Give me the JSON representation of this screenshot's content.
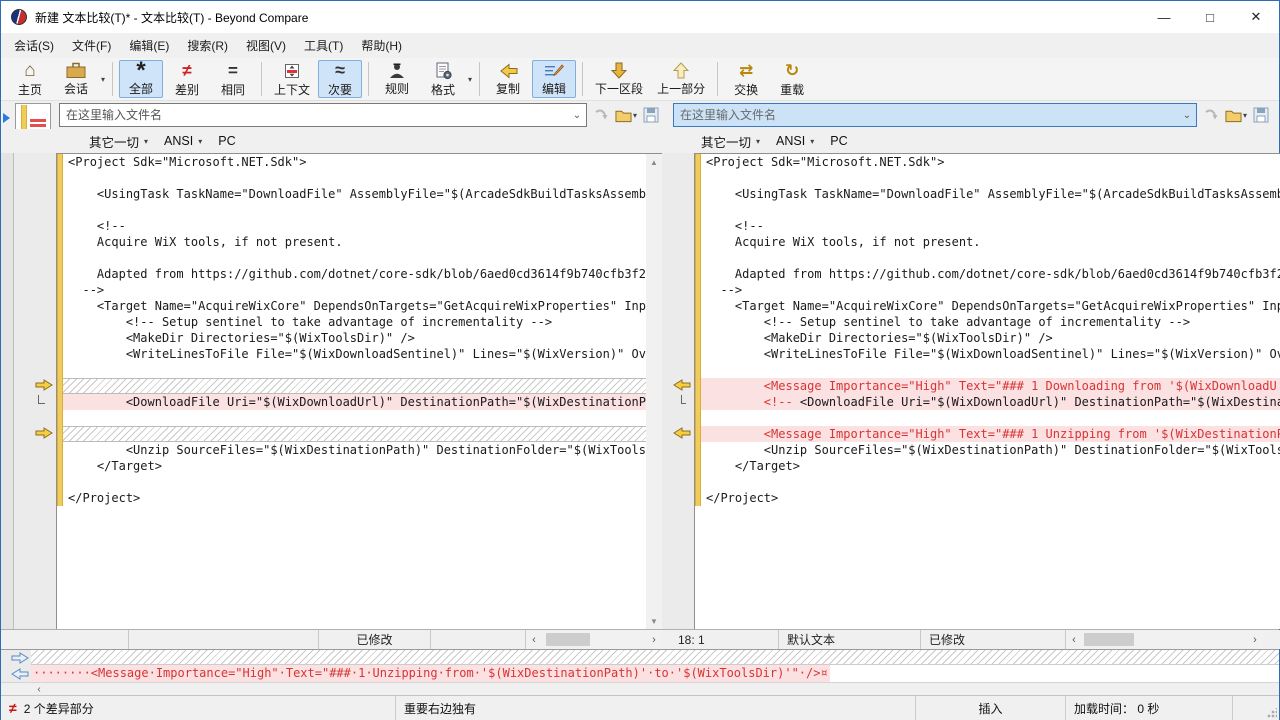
{
  "titlebar": {
    "title": "新建 文本比较(T)* - 文本比较(T) - Beyond Compare",
    "minimize": "—",
    "maximize": "□",
    "close": "✕"
  },
  "menubar": [
    "会话(S)",
    "文件(F)",
    "编辑(E)",
    "搜索(R)",
    "视图(V)",
    "工具(T)",
    "帮助(H)"
  ],
  "toolbar": {
    "groups": [
      [
        {
          "name": "home",
          "label": "主页"
        },
        {
          "name": "sessions",
          "label": "会话",
          "dropdown": true
        }
      ],
      [
        {
          "name": "all",
          "label": "全部",
          "active": true
        },
        {
          "name": "differences",
          "label": "差别"
        },
        {
          "name": "same",
          "label": "相同"
        }
      ],
      [
        {
          "name": "context",
          "label": "上下文"
        },
        {
          "name": "minor",
          "label": "次要",
          "active": true
        }
      ],
      [
        {
          "name": "rules",
          "label": "规则"
        },
        {
          "name": "format",
          "label": "格式",
          "dropdown": true
        }
      ],
      [
        {
          "name": "copy",
          "label": "复制"
        },
        {
          "name": "edit",
          "label": "编辑",
          "active": true
        }
      ],
      [
        {
          "name": "next-section",
          "label": "下一区段"
        },
        {
          "name": "prev-section",
          "label": "上一部分"
        }
      ],
      [
        {
          "name": "swap",
          "label": "交换"
        },
        {
          "name": "reload",
          "label": "重载"
        }
      ]
    ]
  },
  "filebar": {
    "placeholder": "在这里输入文件名",
    "format_options": [
      {
        "label": "其它一切",
        "dropdown": true
      },
      {
        "label": "ANSI",
        "dropdown": true
      },
      {
        "label": "PC",
        "dropdown": false
      }
    ]
  },
  "code": {
    "left_lines": [
      {
        "type": "normal",
        "text": "<Project Sdk=\"Microsoft.NET.Sdk\">"
      },
      {
        "type": "normal",
        "text": ""
      },
      {
        "type": "normal",
        "text": "    <UsingTask TaskName=\"DownloadFile\" AssemblyFile=\"$(ArcadeSdkBuildTasksAssemb"
      },
      {
        "type": "normal",
        "text": ""
      },
      {
        "type": "normal",
        "text": "    <!--"
      },
      {
        "type": "normal",
        "text": "    Acquire WiX tools, if not present."
      },
      {
        "type": "normal",
        "text": ""
      },
      {
        "type": "normal",
        "text": "    Adapted from https://github.com/dotnet/core-sdk/blob/6aed0cd3614f9b740cfb3f2"
      },
      {
        "type": "normal",
        "text": "  -->"
      },
      {
        "type": "normal",
        "text": "    <Target Name=\"AcquireWixCore\" DependsOnTargets=\"GetAcquireWixProperties\" Inp"
      },
      {
        "type": "normal",
        "text": "        <!-- Setup sentinel to take advantage of incrementality -->"
      },
      {
        "type": "normal",
        "text": "        <MakeDir Directories=\"$(WixToolsDir)\" />"
      },
      {
        "type": "normal",
        "text": "        <WriteLinesToFile File=\"$(WixDownloadSentinel)\" Lines=\"$(WixVersion)\" Ov"
      },
      {
        "type": "normal",
        "text": ""
      },
      {
        "type": "gap",
        "marker": "arrow"
      },
      {
        "type": "changed",
        "marker": "bracket",
        "text": "        <DownloadFile Uri=\"$(WixDownloadUrl)\" DestinationPath=\"$(WixDestinationP"
      },
      {
        "type": "normal",
        "text": ""
      },
      {
        "type": "gap",
        "marker": "arrow"
      },
      {
        "type": "normal",
        "text": "        <Unzip SourceFiles=\"$(WixDestinationPath)\" DestinationFolder=\"$(WixTools"
      },
      {
        "type": "normal",
        "text": "    </Target>"
      },
      {
        "type": "normal",
        "text": ""
      },
      {
        "type": "normal",
        "text": "</Project>"
      }
    ],
    "right_lines": [
      {
        "type": "normal",
        "text": "<Project Sdk=\"Microsoft.NET.Sdk\">"
      },
      {
        "type": "normal",
        "text": ""
      },
      {
        "type": "normal",
        "text": "    <UsingTask TaskName=\"DownloadFile\" AssemblyFile=\"$(ArcadeSdkBuildTasksAssemb"
      },
      {
        "type": "normal",
        "text": ""
      },
      {
        "type": "normal",
        "text": "    <!--"
      },
      {
        "type": "normal",
        "text": "    Acquire WiX tools, if not present."
      },
      {
        "type": "normal",
        "text": ""
      },
      {
        "type": "normal",
        "text": "    Adapted from https://github.com/dotnet/core-sdk/blob/6aed0cd3614f9b740cfb3f2"
      },
      {
        "type": "normal",
        "text": "  -->"
      },
      {
        "type": "normal",
        "text": "    <Target Name=\"AcquireWixCore\" DependsOnTargets=\"GetAcquireWixProperties\" Inp"
      },
      {
        "type": "normal",
        "text": "        <!-- Setup sentinel to take advantage of incrementality -->"
      },
      {
        "type": "normal",
        "text": "        <MakeDir Directories=\"$(WixToolsDir)\" />"
      },
      {
        "type": "normal",
        "text": "        <WriteLinesToFile File=\"$(WixDownloadSentinel)\" Lines=\"$(WixVersion)\" Ov"
      },
      {
        "type": "normal",
        "text": ""
      },
      {
        "type": "changed",
        "marker": "arrow",
        "segments": [
          {
            "red": true,
            "text": "        <Message Importance=\"High\" Text=\"### 1 Downloading from '$(WixDownloadU"
          }
        ]
      },
      {
        "type": "changed",
        "marker": "bracket",
        "segments": [
          {
            "red": true,
            "text": "        <!-- "
          },
          {
            "red": false,
            "text": "<DownloadFile Uri=\"$(WixDownloadUrl)\" DestinationPath=\"$(WixDestina"
          }
        ]
      },
      {
        "type": "normal",
        "text": ""
      },
      {
        "type": "changed",
        "marker": "arrow",
        "segments": [
          {
            "red": true,
            "text": "        <Message Importance=\"High\" Text=\"### 1 Unzipping from '$(WixDestinationP"
          }
        ]
      },
      {
        "type": "normal",
        "text": "        <Unzip SourceFiles=\"$(WixDestinationPath)\" DestinationFolder=\"$(WixTools"
      },
      {
        "type": "normal",
        "text": "    </Target>"
      },
      {
        "type": "normal",
        "text": ""
      },
      {
        "type": "normal",
        "text": "</Project>"
      }
    ]
  },
  "pane_status": {
    "left": {
      "modified": "已修改"
    },
    "right": {
      "position": "18: 1",
      "syntax": "默认文本",
      "modified": "已修改"
    }
  },
  "detail": {
    "text": "········<Message·Importance=\"High\"·Text=\"###·1·Unzipping·from·'$(WixDestinationPath)'·to·'$(WixToolsDir)'\"·/>",
    "eol": "¤"
  },
  "statusbar": {
    "diff_count": "2 个差异部分",
    "section_info": "重要右边独有",
    "mode": "插入",
    "load_time": "加载时间： 0 秒"
  }
}
